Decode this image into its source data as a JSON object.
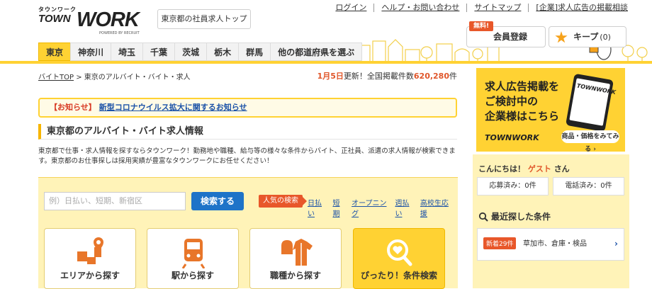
{
  "header": {
    "logo": {
      "kana": "タウンワーク",
      "town": "TOWN",
      "work": "WORK",
      "powered": "POWERED BY RECRUIT"
    },
    "top_button": "東京都の社員求人トップ",
    "links": [
      "ログイン",
      "ヘルプ・お問い合わせ",
      "サイトマップ",
      "[企業]求人広告の掲載相談"
    ],
    "free_badge": "無料!",
    "member_register": "会員登録",
    "keep": {
      "label": "キープ",
      "count": "(0)"
    },
    "prefectures": [
      "東京",
      "神奈川",
      "埼玉",
      "千葉",
      "茨城",
      "栃木",
      "群馬",
      "他の都道府県を選ぶ"
    ],
    "active_prefecture": "東京"
  },
  "breadcrumb": {
    "top": "バイトTOP",
    "sep": ">",
    "current": "東京のアルバイト・バイト・求人"
  },
  "update": {
    "date": "1月5日",
    "text1": "更新！全国掲載件数",
    "count": "620,280",
    "unit": "件"
  },
  "notice": {
    "label": "【お知らせ】",
    "link": "新型コロナウイルス拡大に関するお知らせ"
  },
  "section_title": "東京都のアルバイト・バイト求人情報",
  "description": "東京都で仕事・求人情報を探すならタウンワーク！勤務地や職種、給与等の様々な条件からバイト、正社員、派遣の求人情報が検索できます。東京都のお仕事探しは採用実績が豊富なタウンワークにお任せください！",
  "search": {
    "placeholder": "例）日払い、短期、新宿区",
    "button": "検索する",
    "popular_tag": "人気の検索",
    "keywords": [
      "日払い",
      "短期",
      "オープニング",
      "週払い",
      "高校生応援"
    ]
  },
  "categories": [
    {
      "label": "エリアから探す",
      "icon": "area-map-icon"
    },
    {
      "label": "駅から探す",
      "icon": "train-icon"
    },
    {
      "label": "職種から探す",
      "icon": "uniform-icon"
    },
    {
      "label": "ぴったり！条件検索",
      "icon": "magnifier-heart-icon"
    }
  ],
  "ad": {
    "lines": [
      "求人広告掲載を",
      "ご検討中の",
      "企業様はこちら"
    ],
    "logo": "TOWNWORK",
    "phone_logo": "TOWNWORK",
    "button": "商品・価格をみてみる ›"
  },
  "sidebar": {
    "greeting_pre": "こんにちは！",
    "guest": "ゲスト",
    "greeting_post": "さん",
    "applied": "応募済み：0件",
    "phoned": "電話済み：0件",
    "recent_title": "最近探した条件",
    "recent_badge": "新着29件",
    "recent_text": "草加市、倉庫・検品",
    "recent_chevron": "›"
  },
  "colors": {
    "accent": "#ffd233",
    "link": "#1b52a8",
    "alert": "#e8572a",
    "button": "#1e73c8"
  }
}
